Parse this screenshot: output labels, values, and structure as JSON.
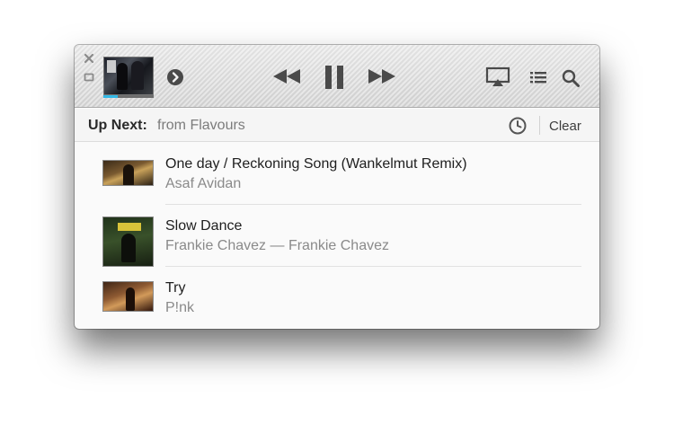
{
  "player": {
    "progress": 0.28,
    "accent_color": "#33b9e6",
    "icons": [
      "close-icon",
      "mini-player-icon",
      "arrow-right-icon",
      "rewind-icon",
      "pause-icon",
      "fast-forward-icon",
      "airplay-icon",
      "list-icon",
      "search-icon"
    ]
  },
  "up_next": {
    "title": "Up Next:",
    "source": "from Flavours",
    "clear_label": "Clear",
    "history_icon": "clock-icon"
  },
  "tracks": [
    {
      "title": "One day / Reckoning Song (Wankelmut Remix)",
      "subtitle": "Asaf Avidan"
    },
    {
      "title": "Slow Dance",
      "subtitle": "Frankie Chavez — Frankie Chavez"
    },
    {
      "title": "Try",
      "subtitle": "P!nk"
    }
  ]
}
